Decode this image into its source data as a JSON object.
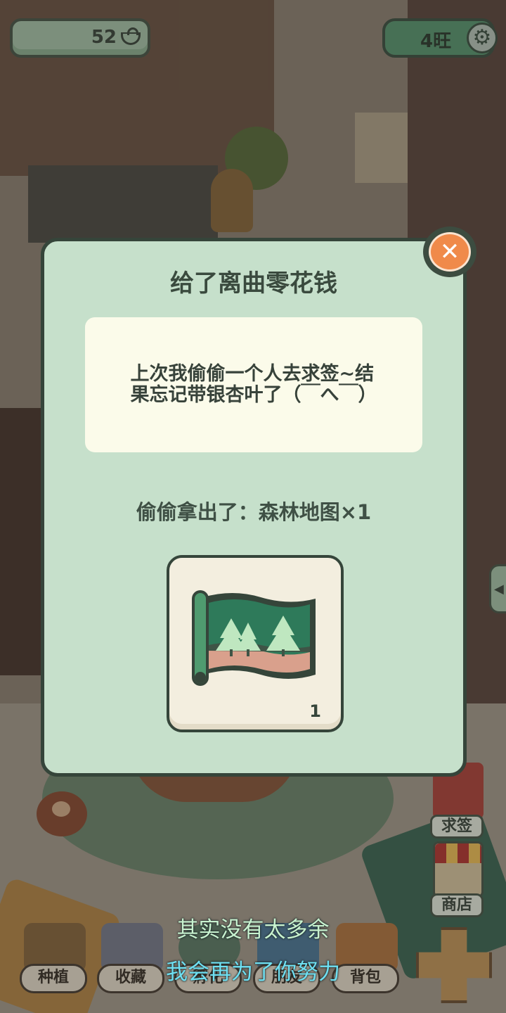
{
  "hud": {
    "coins": "52",
    "coin_icon": "ingot-icon",
    "wang": "4旺",
    "settings_icon": "gear-icon"
  },
  "dialog": {
    "title": "给了离曲零花钱",
    "message_line1": "上次我偷偷一个人去求签~结",
    "message_line2": "果忘记带银杏叶了（￣へ￣）",
    "reward_text": "偷偷拿出了：森林地图×1",
    "item": {
      "icon": "forest-map-icon",
      "count": "1"
    },
    "close_icon": "close-icon"
  },
  "side_buttons": {
    "qiuqian": "求签",
    "shop": "商店"
  },
  "nav": {
    "plant": "种植",
    "collect": "收藏",
    "hatch": "孵化",
    "friends": "朋友",
    "bag": "背包"
  },
  "lyrics": {
    "line1": "其实没有太多余",
    "line2": "我会再为了你努力"
  },
  "colors": {
    "dialog_bg": "#c6e0cb",
    "dialog_border": "#35453a",
    "message_bg": "#fbfbea",
    "close_orange": "#f08a4a",
    "lyric_line1": "#c8f2cf",
    "lyric_line2": "#6fe0f2"
  }
}
